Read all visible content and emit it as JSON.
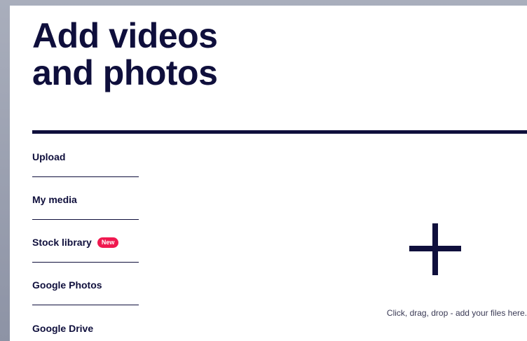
{
  "modal": {
    "title": "Add videos\nand photos"
  },
  "sidebar": {
    "items": [
      {
        "label": "Upload"
      },
      {
        "label": "My media"
      },
      {
        "label": "Stock library",
        "badge": "New"
      },
      {
        "label": "Google Photos"
      },
      {
        "label": "Google Drive"
      }
    ]
  },
  "drop_zone": {
    "icon": "plus-icon",
    "hint": "Click, drag, drop - add your files here."
  },
  "colors": {
    "primary": "#0f0f3c",
    "badge": "#f0184f",
    "background": "#ffffff",
    "backdrop": "#9ba0b0"
  }
}
